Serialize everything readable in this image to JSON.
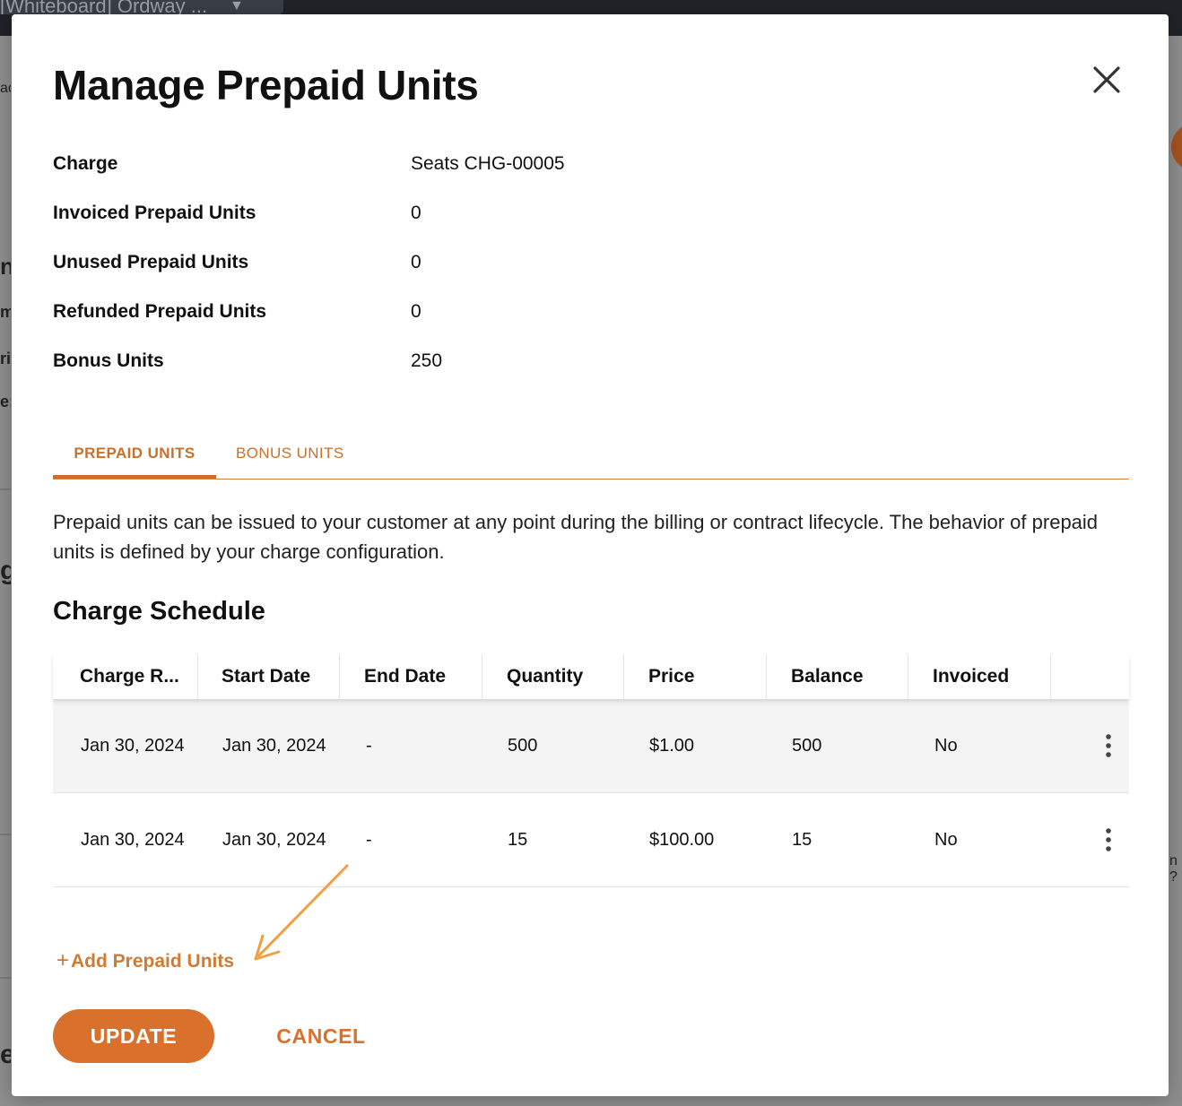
{
  "background": {
    "tab_title": "[Whiteboard] Ordway ...",
    "fragments": [
      "ac",
      "nl",
      "m",
      "ri",
      "e:",
      "g",
      "e"
    ],
    "right_fragment": "n ?"
  },
  "modal": {
    "title": "Manage Prepaid Units",
    "close_icon": "close-icon",
    "summary": [
      {
        "label": "Charge",
        "value": "Seats CHG-00005"
      },
      {
        "label": "Invoiced Prepaid Units",
        "value": "0"
      },
      {
        "label": "Unused Prepaid Units",
        "value": "0"
      },
      {
        "label": "Refunded Prepaid Units",
        "value": "0"
      },
      {
        "label": "Bonus Units",
        "value": "250"
      }
    ],
    "tabs": [
      {
        "label": "PREPAID UNITS",
        "active": true
      },
      {
        "label": "BONUS UNITS",
        "active": false
      }
    ],
    "description": "Prepaid units can be issued to your customer at any point during the billing or contract lifecycle. The behavior of prepaid units is defined by your charge configuration.",
    "schedule_title": "Charge Schedule",
    "table": {
      "columns": [
        "Charge R...",
        "Start Date",
        "End Date",
        "Quantity",
        "Price",
        "Balance",
        "Invoiced"
      ],
      "rows": [
        [
          "Jan 30, 2024",
          "Jan 30, 2024",
          "-",
          "500",
          "$1.00",
          "500",
          "No"
        ],
        [
          "Jan 30, 2024",
          "Jan 30, 2024",
          "-",
          "15",
          "$100.00",
          "15",
          "No"
        ]
      ],
      "row_menu_icon": "kebab-menu-icon"
    },
    "add_link": {
      "plus": "+",
      "label": "Add Prepaid Units"
    },
    "buttons": {
      "update": "UPDATE",
      "cancel": "CANCEL"
    },
    "colors": {
      "accent": "#d9712d",
      "arrow": "#f0a040"
    }
  }
}
